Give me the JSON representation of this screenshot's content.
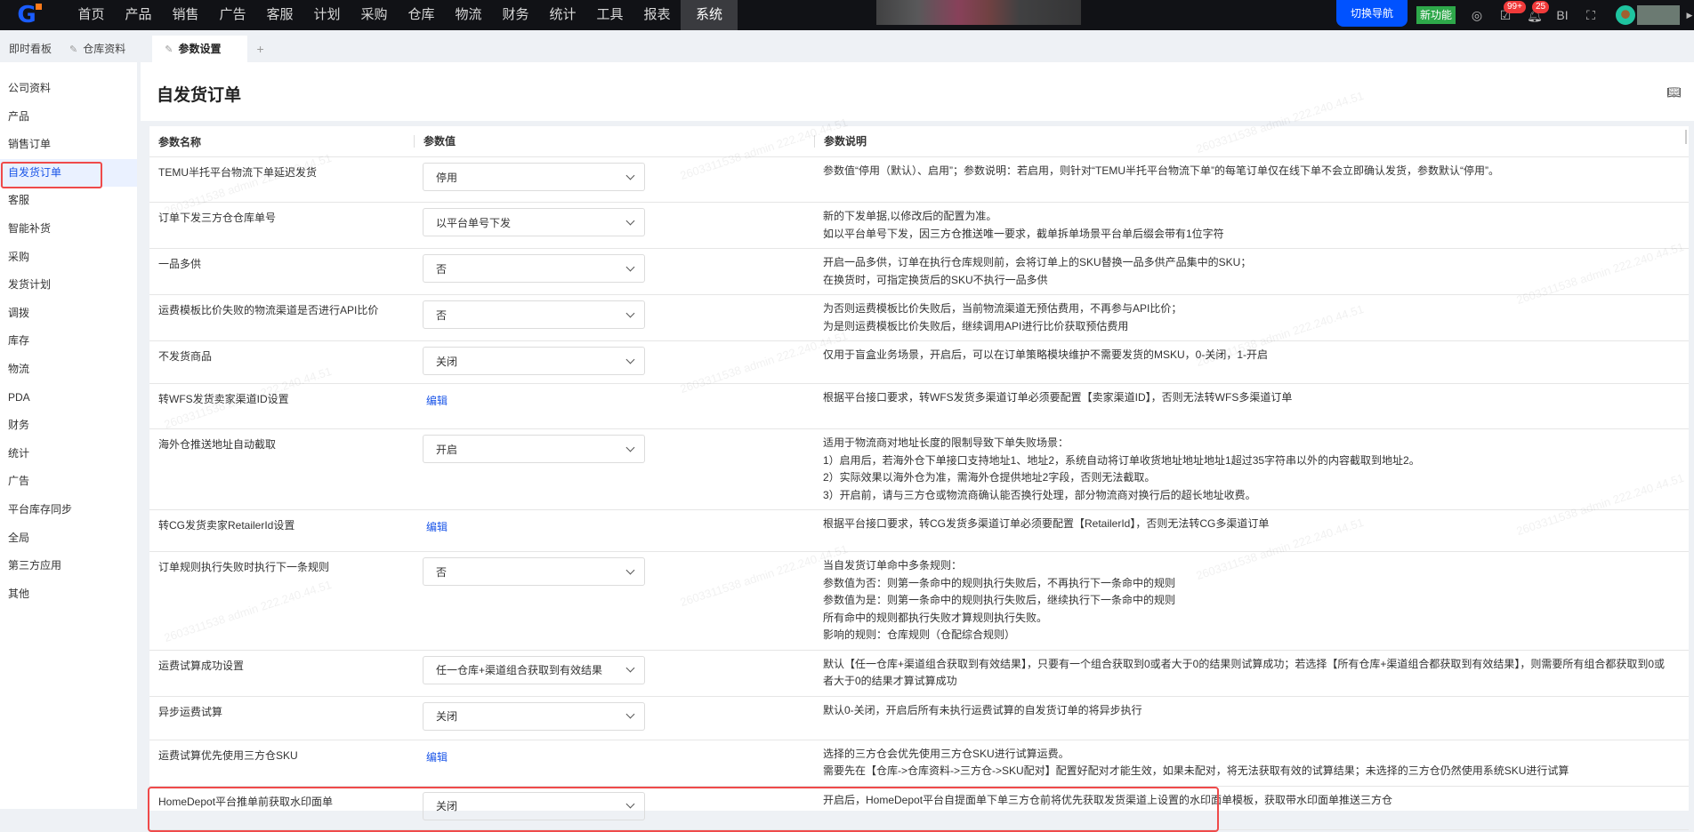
{
  "topbar": {
    "menu": [
      "首页",
      "产品",
      "销售",
      "广告",
      "客服",
      "计划",
      "采购",
      "仓库",
      "物流",
      "财务",
      "统计",
      "工具",
      "报表",
      "系统"
    ],
    "active": "系统",
    "switch_nav": "切换导航",
    "new_feature": "新功能",
    "task_badge": "99+",
    "bell_badge": "25",
    "bi_label": "BI"
  },
  "tabs": [
    {
      "label": "即时看板"
    },
    {
      "label": "仓库资料"
    },
    {
      "label": "参数设置"
    }
  ],
  "tab_add": "+",
  "sidebar": {
    "items": [
      "公司资料",
      "产品",
      "销售订单",
      "自发货订单",
      "客服",
      "智能补货",
      "采购",
      "发货计划",
      "调拨",
      "库存",
      "物流",
      "PDA",
      "财务",
      "统计",
      "广告",
      "平台库存同步",
      "全局",
      "第三方应用",
      "其他"
    ],
    "active": "自发货订单"
  },
  "page": {
    "title": "自发货订单"
  },
  "table": {
    "headers": [
      "参数名称",
      "参数值",
      "参数说明"
    ],
    "edit_label": "编辑",
    "rows": [
      {
        "name": "TEMU半托平台物流下单延迟发货",
        "value": "停用",
        "desc": [
          "参数值“停用（默认）、启用”；参数说明：若启用，则针对“TEMU半托平台物流下单”的每笔订单仅在线下单不会立即确认发货，参数默认“停用”。"
        ]
      },
      {
        "name": "订单下发三方仓仓库单号",
        "value": "以平台单号下发",
        "desc": [
          "新的下发单据,以修改后的配置为准。",
          "如以平台单号下发，因三方仓推送唯一要求，截单拆单场景平台单后缀会带有1位字符"
        ]
      },
      {
        "name": "一品多供",
        "value": "否",
        "desc": [
          "开启一品多供，订单在执行仓库规则前，会将订单上的SKU替换一品多供产品集中的SKU；",
          "在换货时，可指定换货后的SKU不执行一品多供"
        ]
      },
      {
        "name": "运费模板比价失败的物流渠道是否进行API比价",
        "value": "否",
        "desc": [
          "为否则运费模板比价失败后，当前物流渠道无预估费用，不再参与API比价；",
          "为是则运费模板比价失败后，继续调用API进行比价获取预估费用"
        ]
      },
      {
        "name": "不发货商品",
        "value": "关闭",
        "desc": [
          "仅用于盲盒业务场景，开启后，可以在订单策略模块维护不需要发货的MSKU，0-关闭，1-开启"
        ]
      },
      {
        "name": "转WFS发货卖家渠道ID设置",
        "value": null,
        "edit": true,
        "desc": [
          "根据平台接口要求，转WFS发货多渠道订单必须要配置【卖家渠道ID】，否则无法转WFS多渠道订单"
        ]
      },
      {
        "name": "海外仓推送地址自动截取",
        "value": "开启",
        "desc": [
          "适用于物流商对地址长度的限制导致下单失败场景：",
          "1）启用后，若海外仓下单接口支持地址1、地址2，系统自动将订单收货地址地址地址1超过35字符串以外的内容截取到地址2。",
          "2）实际效果以海外仓为准，需海外仓提供地址2字段，否则无法截取。",
          "3）开启前，请与三方仓或物流商确认能否换行处理，部分物流商对换行后的超长地址收费。"
        ]
      },
      {
        "name": "转CG发货卖家RetailerId设置",
        "value": null,
        "edit": true,
        "desc": [
          "根据平台接口要求，转CG发货多渠道订单必须要配置【RetailerId】，否则无法转CG多渠道订单"
        ]
      },
      {
        "name": "订单规则执行失败时执行下一条规则",
        "value": "否",
        "desc": [
          "当自发货订单命中多条规则：",
          "参数值为否：则第一条命中的规则执行失败后，不再执行下一条命中的规则",
          "参数值为是：则第一条命中的规则执行失败后，继续执行下一条命中的规则",
          "所有命中的规则都执行失败才算规则执行失败。",
          "影响的规则：仓库规则（仓配综合规则）"
        ]
      },
      {
        "name": "运费试算成功设置",
        "value": "任一仓库+渠道组合获取到有效结果",
        "desc": [
          "默认【任一仓库+渠道组合获取到有效结果】，只要有一个组合获取到0或者大于0的结果则试算成功；若选择【所有仓库+渠道组合都获取到有效结果】，则需要所有组合都获取到0或",
          "者大于0的结果才算试算成功"
        ]
      },
      {
        "name": "异步运费试算",
        "value": "关闭",
        "desc": [
          "默认0-关闭，开启后所有未执行运费试算的自发货订单的将异步执行"
        ]
      },
      {
        "name": "运费试算优先使用三方仓SKU",
        "value": null,
        "edit": true,
        "desc": [
          "选择的三方仓会优先使用三方仓SKU进行试算运费。",
          "需要先在【仓库->仓库资料->三方仓->SKU配对】配置好配对才能生效，如果未配对，将无法获取有效的试算结果；未选择的三方仓仍然使用系统SKU进行试算"
        ]
      },
      {
        "name": "HomeDepot平台推单前获取水印面单",
        "value": "关闭",
        "highlight": true,
        "desc": [
          "开启后，HomeDepot平台自提面单下单三方仓前将优先获取发货渠道上设置的水印面单模板，获取带水印面单推送三方仓"
        ]
      }
    ]
  },
  "watermark": "2603311538 admin 222.240.44.51"
}
